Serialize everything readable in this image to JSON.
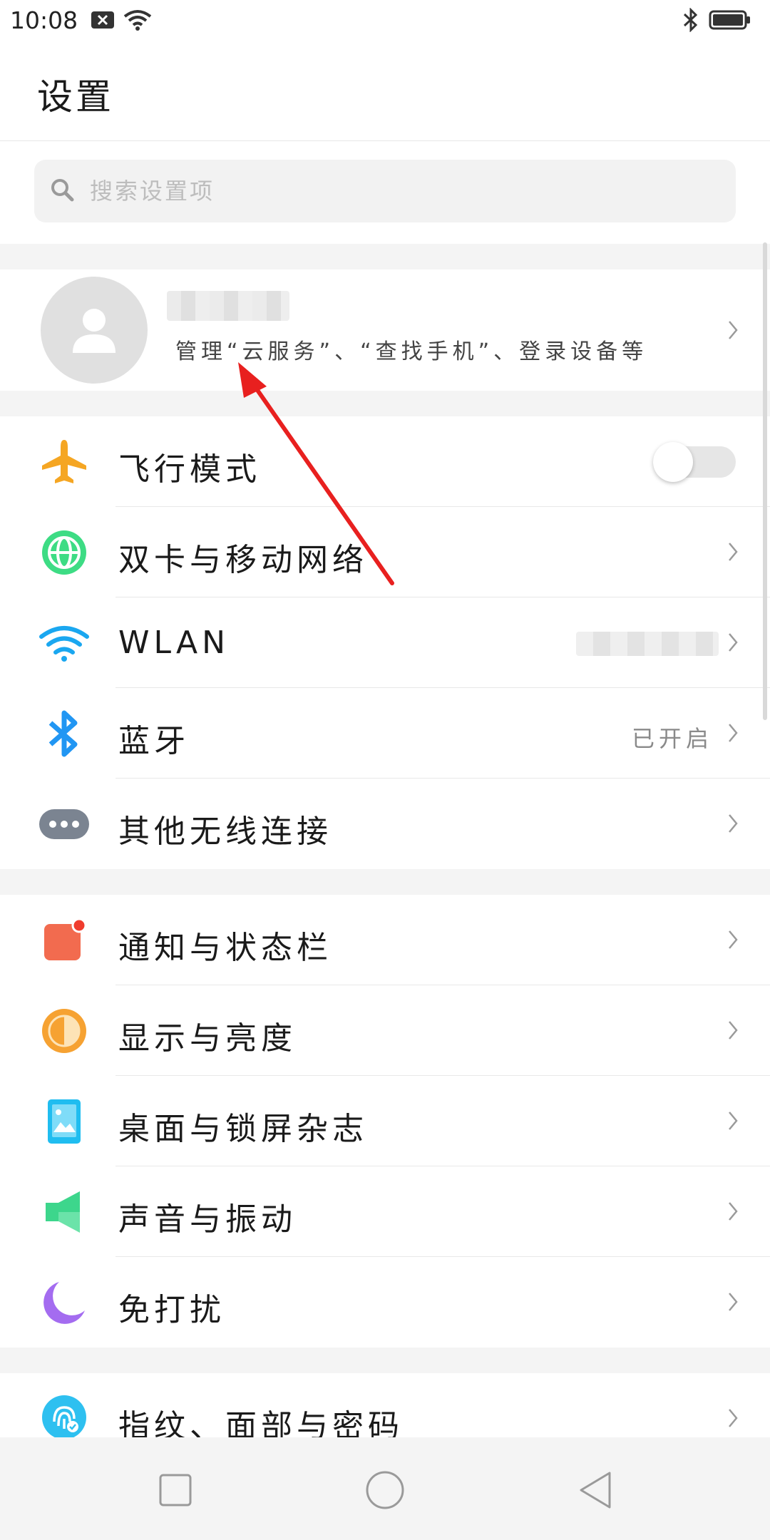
{
  "status_bar": {
    "time": "10:08",
    "icons": [
      "notification-x-icon",
      "wifi-icon",
      "bluetooth-icon",
      "battery-icon"
    ]
  },
  "header": {
    "title": "设置"
  },
  "search": {
    "placeholder": "搜索设置项"
  },
  "account": {
    "subtitle": "管理“云服务”、“查找手机”、登录设备等"
  },
  "groups": [
    {
      "items": [
        {
          "label": "飞行模式",
          "icon": "airplane-icon",
          "control": "toggle",
          "toggle_on": false
        },
        {
          "label": "双卡与移动网络",
          "icon": "globe-icon"
        },
        {
          "label": "WLAN",
          "icon": "wifi-icon"
        },
        {
          "label": "蓝牙",
          "icon": "bluetooth-icon",
          "value": "已开启"
        },
        {
          "label": "其他无线连接",
          "icon": "more-dots-icon"
        }
      ]
    },
    {
      "items": [
        {
          "label": "通知与状态栏",
          "icon": "notification-icon"
        },
        {
          "label": "显示与亮度",
          "icon": "brightness-icon"
        },
        {
          "label": "桌面与锁屏杂志",
          "icon": "wallpaper-icon"
        },
        {
          "label": "声音与振动",
          "icon": "speaker-icon"
        },
        {
          "label": "免打扰",
          "icon": "moon-icon"
        }
      ]
    },
    {
      "items": [
        {
          "label": "指纹、面部与密码",
          "icon": "fingerprint-icon"
        }
      ]
    }
  ],
  "colors": {
    "airplane": "#f5a623",
    "globe": "#3ddc84",
    "wifi": "#1aa7f0",
    "bluetooth": "#2196f3",
    "more": "#7b8491",
    "notification": "#f26b4f",
    "brightness": "#f6a232",
    "wallpaper": "#20bdf0",
    "speaker": "#3dd68c",
    "moon": "#a46cf0",
    "fingerprint": "#2ec0f0",
    "annotation_arrow": "#e8201f"
  },
  "nav_bar": {
    "buttons": [
      "recents-square-icon",
      "home-circle-icon",
      "back-triangle-icon"
    ]
  }
}
